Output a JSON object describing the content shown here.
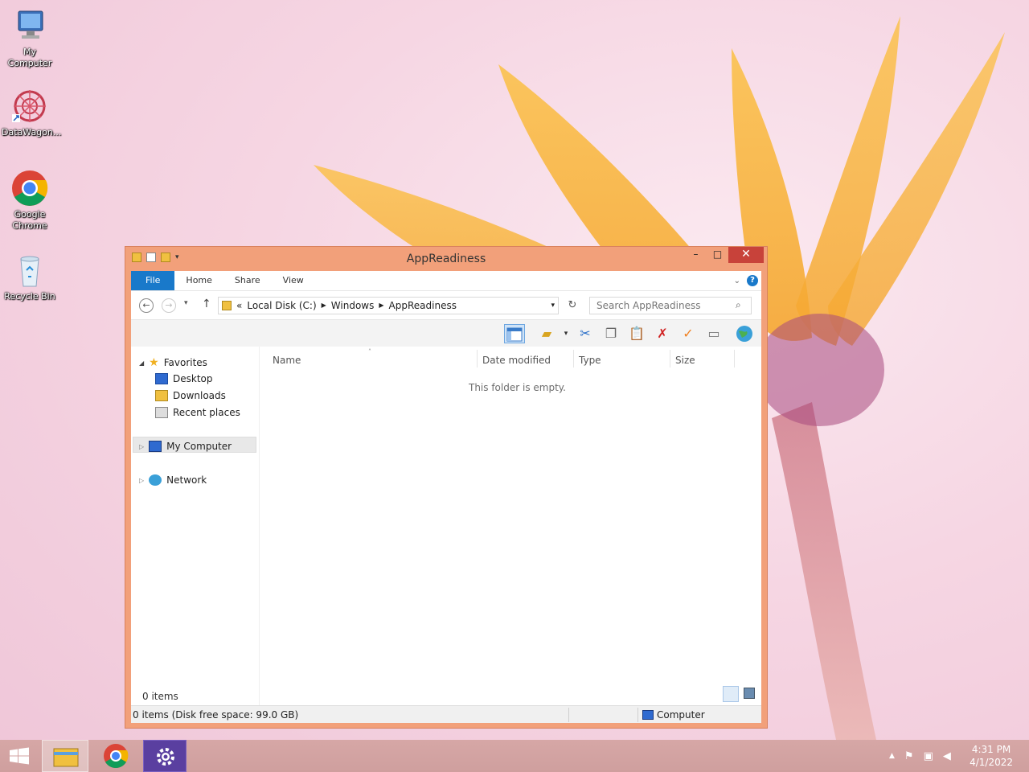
{
  "desktop": {
    "icons": [
      {
        "label": "My Computer"
      },
      {
        "label": "DataWagon..."
      },
      {
        "label": "Google Chrome"
      },
      {
        "label": "Recycle Bin"
      }
    ]
  },
  "window": {
    "title": "AppReadiness",
    "controls": {
      "minimize": "–",
      "maximize": "□",
      "close": "✕"
    },
    "ribbon_tabs": [
      "File",
      "Home",
      "Share",
      "View"
    ],
    "address": {
      "prefix": "«",
      "crumbs": [
        "Local Disk (C:)",
        "Windows",
        "AppReadiness"
      ]
    },
    "search_placeholder": "Search AppReadiness",
    "nav": {
      "favorites": "Favorites",
      "desktop": "Desktop",
      "downloads": "Downloads",
      "recent": "Recent places",
      "my_computer": "My Computer",
      "network": "Network"
    },
    "columns": [
      "Name",
      "Date modified",
      "Type",
      "Size"
    ],
    "empty_message": "This folder is empty.",
    "item_count": "0 items",
    "status_left": "0 items (Disk free space: 99.0 GB)",
    "status_right": "Computer"
  },
  "taskbar": {
    "clock_time": "4:31 PM",
    "clock_date": "4/1/2022"
  },
  "colors": {
    "window_frame": "#f2a07a",
    "file_tab": "#1979ca",
    "close_button": "#c8423a"
  }
}
